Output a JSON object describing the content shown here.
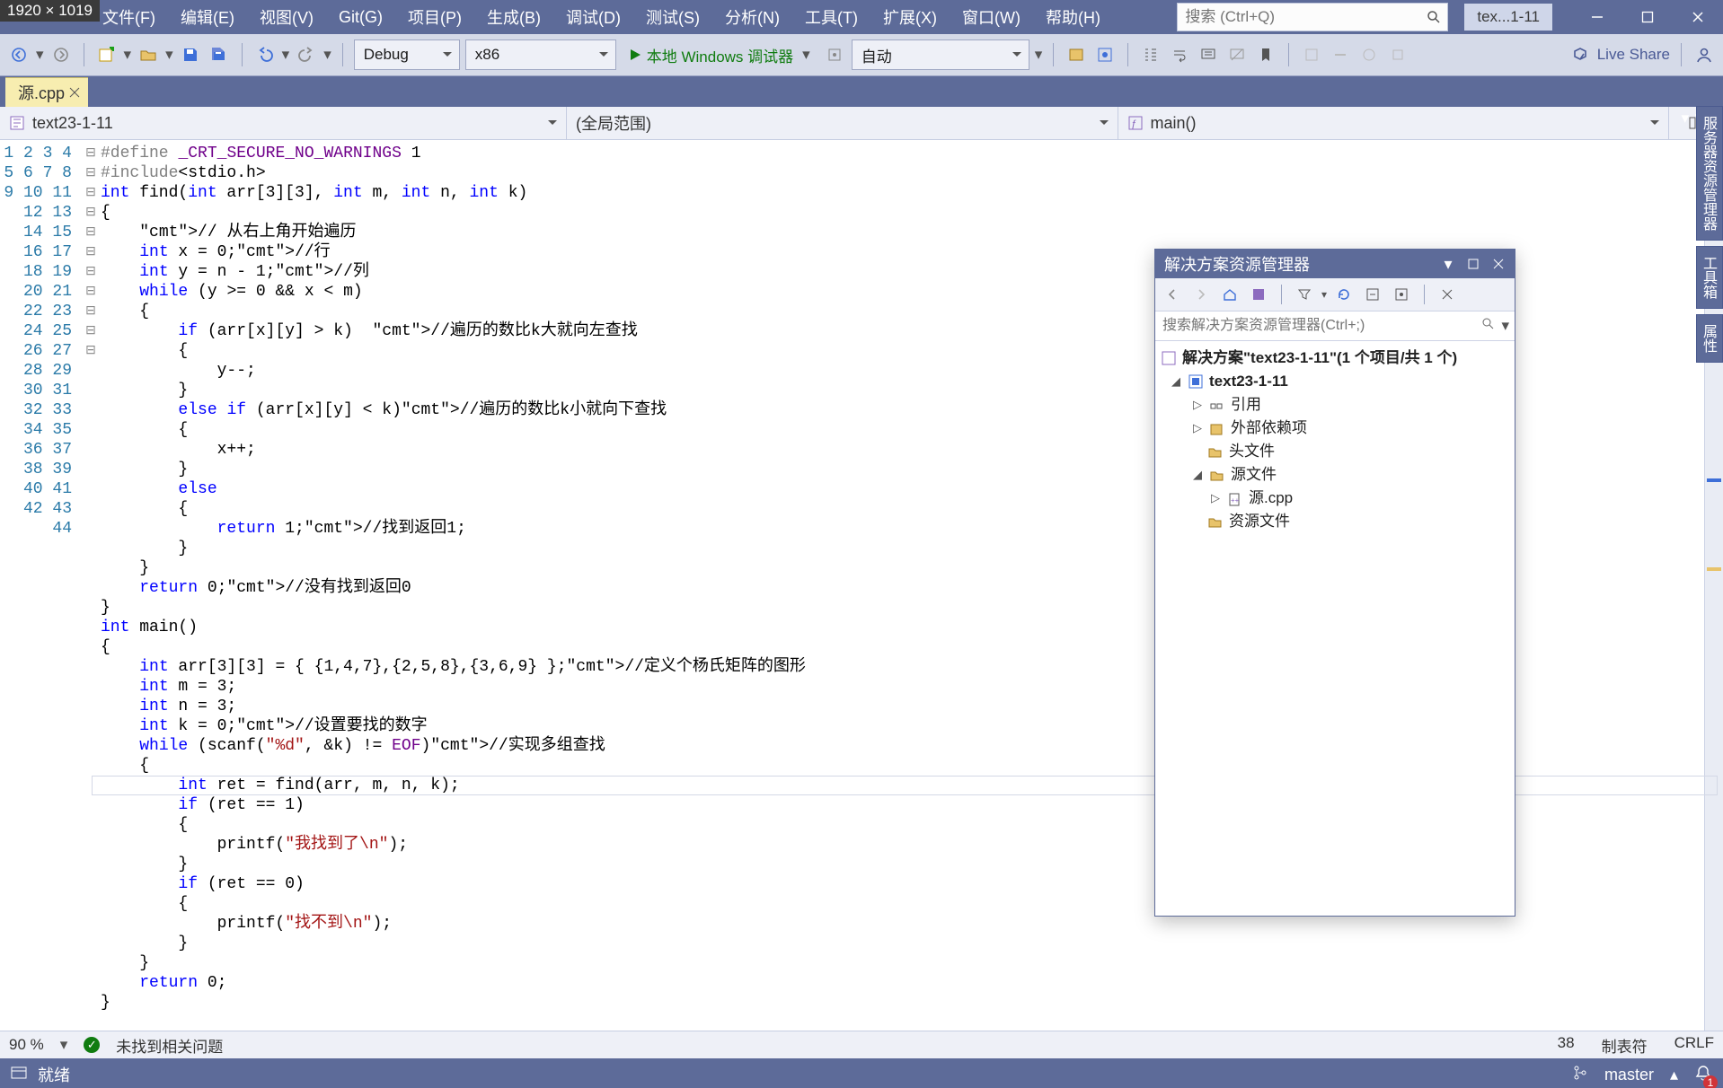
{
  "dimBadge": "1920 × 1019",
  "menubar": [
    "文件(F)",
    "编辑(E)",
    "视图(V)",
    "Git(G)",
    "项目(P)",
    "生成(B)",
    "调试(D)",
    "测试(S)",
    "分析(N)",
    "工具(T)",
    "扩展(X)",
    "窗口(W)",
    "帮助(H)"
  ],
  "titleSearchPlaceholder": "搜索 (Ctrl+Q)",
  "titleDocBadge": "tex...1-11",
  "toolbar": {
    "config": "Debug",
    "platform": "x86",
    "runLabel": "本地 Windows 调试器",
    "mode": "自动",
    "liveShare": "Live Share"
  },
  "tab": {
    "name": "源.cpp"
  },
  "navbar": {
    "file": "text23-1-11",
    "scope": "(全局范围)",
    "symbol": "main()"
  },
  "code": {
    "lines": 44,
    "raw": [
      "#define _CRT_SECURE_NO_WARNINGS 1",
      "#include<stdio.h>",
      "int find(int arr[3][3], int m, int n, int k)",
      "{",
      "    // 从右上角开始遍历",
      "    int x = 0;//行",
      "    int y = n - 1;//列",
      "    while (y >= 0 && x < m)",
      "    {",
      "        if (arr[x][y] > k)  //遍历的数比k大就向左查找",
      "        {",
      "            y--;",
      "        }",
      "        else if (arr[x][y] < k)//遍历的数比k小就向下查找",
      "        {",
      "            x++;",
      "        }",
      "        else",
      "        {",
      "            return 1;//找到返回1;",
      "        }",
      "    }",
      "    return 0;//没有找到返回0",
      "}",
      "int main()",
      "{",
      "    int arr[3][3] = { {1,4,7},{2,5,8},{3,6,9} };//定义个杨氏矩阵的图形",
      "    int m = 3;",
      "    int n = 3;",
      "    int k = 0;//设置要找的数字",
      "    while (scanf(\"%d\", &k) != EOF)//实现多组查找",
      "    {",
      "        int ret = find(arr, m, n, k);",
      "        if (ret == 1)",
      "        {",
      "            printf(\"我找到了\\n\");",
      "        }",
      "        if (ret == 0)",
      "        {",
      "            printf(\"找不到\\n\");",
      "        }",
      "    }",
      "    return 0;",
      "}"
    ]
  },
  "editorStatus": {
    "zoom": "90 %",
    "issues": "未找到相关问题",
    "col": "38",
    "tabs": "制表符",
    "eol": "CRLF"
  },
  "solutionExplorer": {
    "title": "解决方案资源管理器",
    "searchPlaceholder": "搜索解决方案资源管理器(Ctrl+;)",
    "root": "解决方案\"text23-1-11\"(1 个项目/共 1 个)",
    "project": "text23-1-11",
    "nodes": {
      "refs": "引用",
      "extDeps": "外部依赖项",
      "headers": "头文件",
      "sources": "源文件",
      "sourceFile": "源.cpp",
      "resources": "资源文件"
    }
  },
  "statusbar": {
    "ready": "就绪",
    "branch": "master",
    "notifications": "1"
  },
  "rightTabs": [
    "服务器资源管理器",
    "工具箱",
    "属性"
  ]
}
